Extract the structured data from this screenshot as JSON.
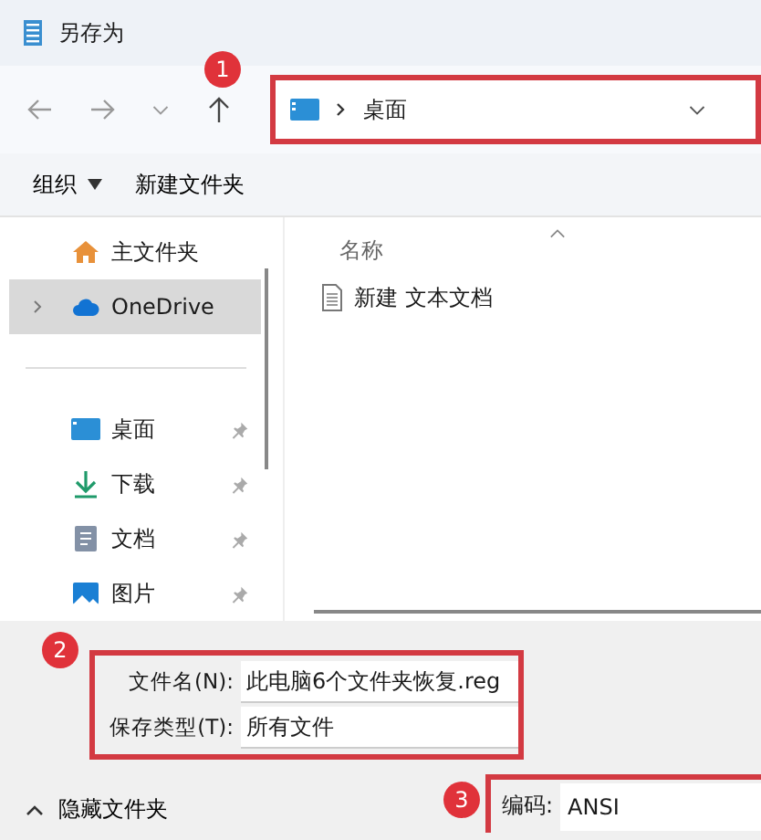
{
  "window": {
    "title": "另存为"
  },
  "address": {
    "path": "桌面"
  },
  "callouts": [
    "1",
    "2",
    "3"
  ],
  "toolbar": {
    "organize": "组织",
    "new_folder": "新建文件夹"
  },
  "sidebar": {
    "items": [
      {
        "kind": "home",
        "label": "主文件夹",
        "selected": false,
        "pinned": false,
        "expandable": false
      },
      {
        "kind": "cloud",
        "label": "OneDrive",
        "selected": true,
        "pinned": false,
        "expandable": true
      },
      {
        "kind": "divider"
      },
      {
        "kind": "desktop",
        "label": "桌面",
        "selected": false,
        "pinned": true,
        "expandable": false
      },
      {
        "kind": "download",
        "label": "下载",
        "selected": false,
        "pinned": true,
        "expandable": false
      },
      {
        "kind": "document",
        "label": "文档",
        "selected": false,
        "pinned": true,
        "expandable": false
      },
      {
        "kind": "picture",
        "label": "图片",
        "selected": false,
        "pinned": true,
        "expandable": false
      }
    ]
  },
  "file_list": {
    "column": "名称",
    "files": [
      {
        "name": "新建 文本文档"
      }
    ]
  },
  "form": {
    "filename_label": "文件名(N):",
    "filename": "此电脑6个文件夹恢复.reg",
    "type_label": "保存类型(T):",
    "type": "所有文件",
    "encoding_label": "编码:",
    "encoding": "ANSI"
  },
  "footer": {
    "hide_folders": "隐藏文件夹"
  }
}
